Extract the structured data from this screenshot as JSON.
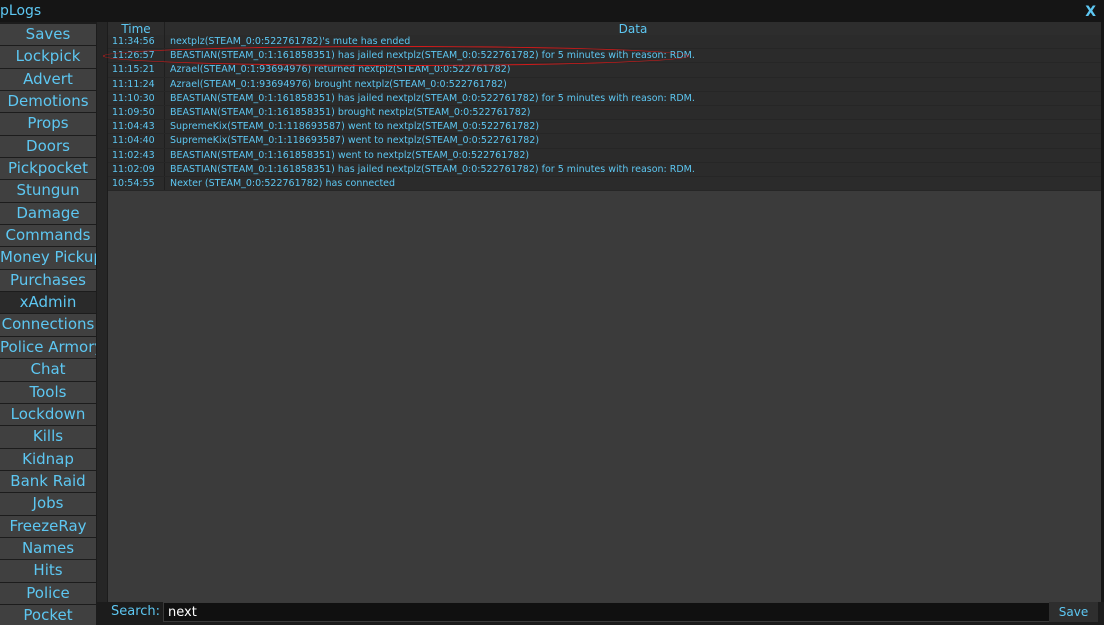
{
  "window": {
    "title": "pLogs",
    "close_label": "X"
  },
  "sidebar": {
    "items": [
      "Saves",
      "Lockpick",
      "Advert",
      "Demotions",
      "Props",
      "Doors",
      "Pickpocket",
      "Stungun",
      "Damage",
      "Commands",
      "Money Pickup",
      "Purchases",
      "xAdmin",
      "Connections",
      "Police Armory",
      "Chat",
      "Tools",
      "Lockdown",
      "Kills",
      "Kidnap",
      "Bank Raid",
      "Jobs",
      "FreezeRay",
      "Names",
      "Hits",
      "Police",
      "Pocket"
    ],
    "selected": "xAdmin"
  },
  "log": {
    "columns": {
      "time": "Time",
      "data": "Data"
    },
    "rows": [
      {
        "time": "11:34:56",
        "data": "nextplz(STEAM_0:0:522761782)'s mute has ended"
      },
      {
        "time": "11:26:57",
        "data": "BEASTIAN(STEAM_0:1:161858351) has jailed nextplz(STEAM_0:0:522761782) for 5 minutes with reason: RDM."
      },
      {
        "time": "11:15:21",
        "data": "Azrael(STEAM_0:1:93694976) returned nextplz(STEAM_0:0:522761782)"
      },
      {
        "time": "11:11:24",
        "data": "Azrael(STEAM_0:1:93694976) brought nextplz(STEAM_0:0:522761782)"
      },
      {
        "time": "11:10:30",
        "data": "BEASTIAN(STEAM_0:1:161858351) has jailed nextplz(STEAM_0:0:522761782) for 5 minutes with reason: RDM."
      },
      {
        "time": "11:09:50",
        "data": "BEASTIAN(STEAM_0:1:161858351) brought nextplz(STEAM_0:0:522761782)"
      },
      {
        "time": "11:04:43",
        "data": "SupremeKix(STEAM_0:1:118693587) went to nextplz(STEAM_0:0:522761782)"
      },
      {
        "time": "11:04:40",
        "data": "SupremeKix(STEAM_0:1:118693587) went to nextplz(STEAM_0:0:522761782)"
      },
      {
        "time": "11:02:43",
        "data": "BEASTIAN(STEAM_0:1:161858351) went to nextplz(STEAM_0:0:522761782)"
      },
      {
        "time": "11:02:09",
        "data": "BEASTIAN(STEAM_0:1:161858351) has jailed nextplz(STEAM_0:0:522761782) for 5 minutes with reason: RDM."
      },
      {
        "time": "10:54:55",
        "data": "Nexter (STEAM_0:0:522761782) has connected"
      }
    ]
  },
  "search": {
    "label": "Search:",
    "value": "next",
    "save_label": "Save"
  },
  "colors": {
    "accent": "#5dc7f2",
    "highlight_annotation": "#d11a1a"
  }
}
